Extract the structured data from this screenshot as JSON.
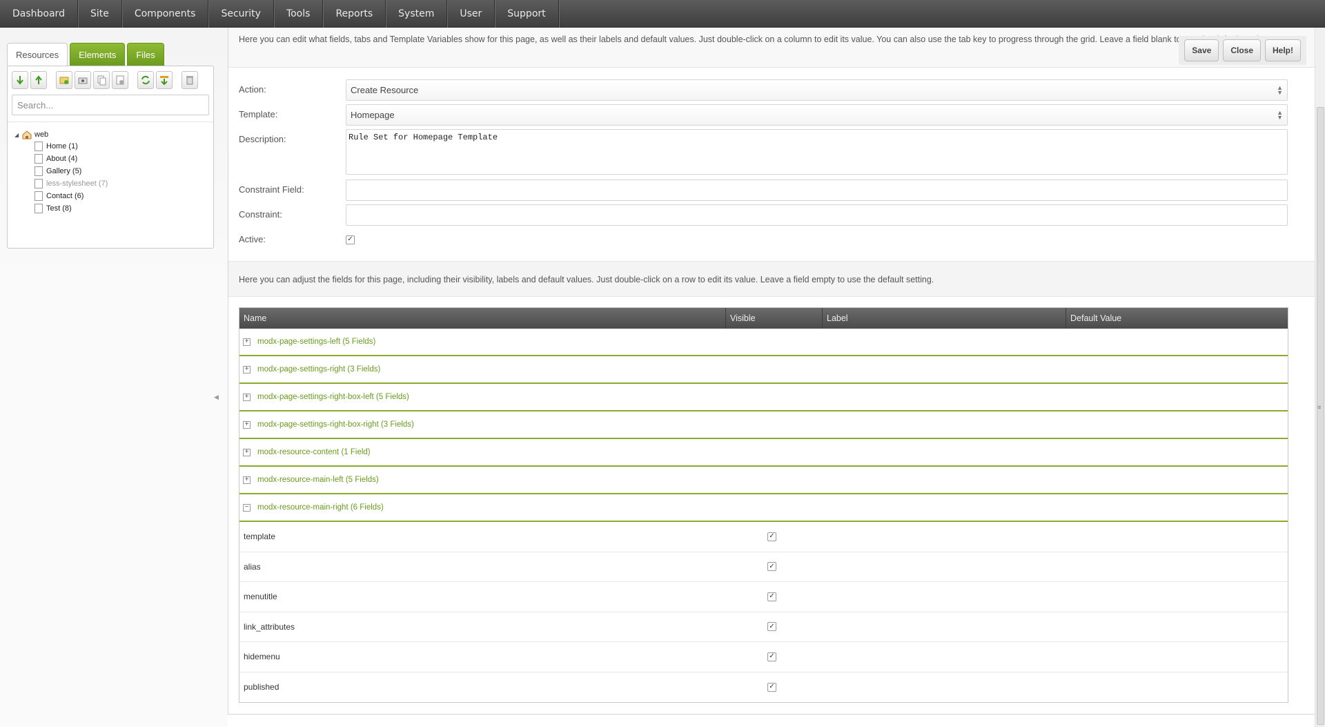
{
  "topnav": [
    "Dashboard",
    "Site",
    "Components",
    "Security",
    "Tools",
    "Reports",
    "System",
    "User",
    "Support"
  ],
  "left": {
    "tabs": [
      "Resources",
      "Elements",
      "Files"
    ],
    "search_placeholder": "Search...",
    "tree": {
      "root": "web",
      "children": [
        {
          "label": "Home",
          "id": "(1)"
        },
        {
          "label": "About",
          "id": "(4)"
        },
        {
          "label": "Gallery",
          "id": "(5)"
        },
        {
          "label": "less-stylesheet",
          "id": "(7)"
        },
        {
          "label": "Contact",
          "id": "(6)"
        },
        {
          "label": "Test",
          "id": "(8)"
        }
      ]
    }
  },
  "intro_text": "Here you can edit what fields, tabs and Template Variables show for this page, as well as their labels and default values. Just double-click on a column to edit its value. You can also use the tab key to progress through the grid. Leave a field blank to use the default setting.",
  "actions": {
    "save": "Save",
    "close": "Close",
    "help": "Help!"
  },
  "form": {
    "action_label": "Action:",
    "action_value": "Create Resource",
    "template_label": "Template:",
    "template_value": "Homepage",
    "description_label": "Description:",
    "description_value": "Rule Set for Homepage Template",
    "constraint_field_label": "Constraint Field:",
    "constraint_field_value": "",
    "constraint_label": "Constraint:",
    "constraint_value": "",
    "active_label": "Active:",
    "active_checked": true
  },
  "fields_intro": "Here you can adjust the fields for this page, including their visibility, labels and default values. Just double-click on a row to edit its value. Leave a field empty to use the default setting.",
  "grid": {
    "columns": [
      "Name",
      "Visible",
      "Label",
      "Default Value"
    ],
    "groups": [
      "modx-page-settings-left (5 Fields)",
      "modx-page-settings-right (3 Fields)",
      "modx-page-settings-right-box-left (5 Fields)",
      "modx-page-settings-right-box-right (3 Fields)",
      "modx-resource-content (1 Field)",
      "modx-resource-main-left (5 Fields)",
      "modx-resource-main-right (6 Fields)"
    ],
    "rows": [
      "template",
      "alias",
      "menutitle",
      "link_attributes",
      "hidemenu",
      "published"
    ]
  }
}
